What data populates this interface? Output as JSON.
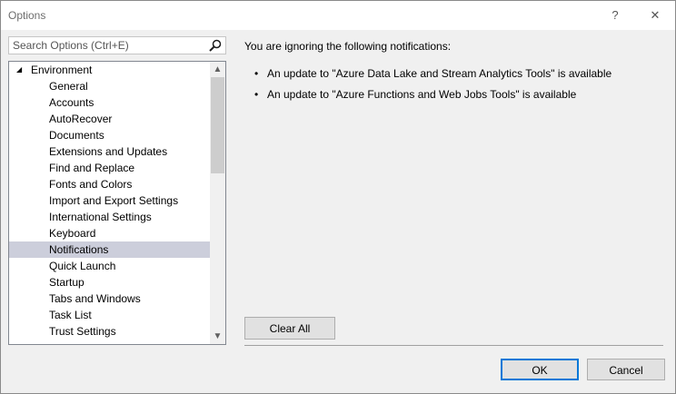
{
  "window": {
    "title": "Options",
    "help_label": "?",
    "close_label": "✕"
  },
  "search": {
    "placeholder": "Search Options (Ctrl+E)",
    "value": "",
    "icon": "search-icon"
  },
  "tree": {
    "root": {
      "label": "Environment",
      "expanded": true,
      "expander_glyph": "◢"
    },
    "items": [
      {
        "label": "General"
      },
      {
        "label": "Accounts"
      },
      {
        "label": "AutoRecover"
      },
      {
        "label": "Documents"
      },
      {
        "label": "Extensions and Updates"
      },
      {
        "label": "Find and Replace"
      },
      {
        "label": "Fonts and Colors"
      },
      {
        "label": "Import and Export Settings"
      },
      {
        "label": "International Settings"
      },
      {
        "label": "Keyboard"
      },
      {
        "label": "Notifications",
        "selected": true
      },
      {
        "label": "Quick Launch"
      },
      {
        "label": "Startup"
      },
      {
        "label": "Tabs and Windows"
      },
      {
        "label": "Task List"
      },
      {
        "label": "Trust Settings"
      }
    ],
    "scroll_up_glyph": "▲",
    "scroll_down_glyph": "▼"
  },
  "content": {
    "heading": "You are ignoring the following notifications:",
    "bullet": "•",
    "notifications": [
      "An update to \"Azure Data Lake and Stream Analytics Tools\" is available",
      "An update to \"Azure Functions and Web Jobs Tools\" is available"
    ],
    "clear_all_label": "Clear All"
  },
  "footer": {
    "ok_label": "OK",
    "cancel_label": "Cancel"
  },
  "colors": {
    "selected_background": "#cccedb",
    "default_button_border": "#0078d7",
    "dialog_background": "#f0f0f0"
  }
}
